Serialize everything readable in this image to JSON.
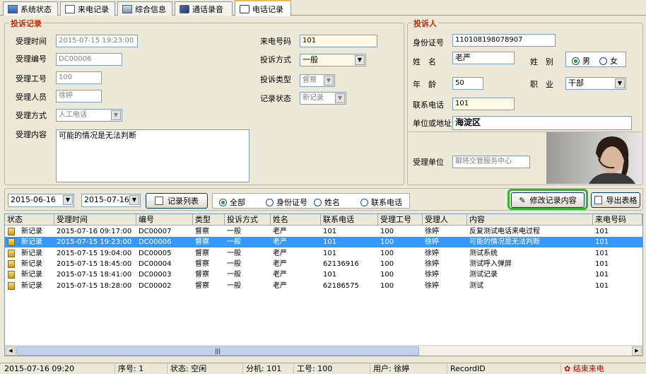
{
  "tabs": [
    {
      "label": "系统状态",
      "icon": "system-status-icon"
    },
    {
      "label": "来电记录",
      "icon": "call-log-icon"
    },
    {
      "label": "综合信息",
      "icon": "info-icon"
    },
    {
      "label": "通话录音",
      "icon": "recording-icon"
    },
    {
      "label": "电话记录",
      "icon": "phone-record-icon"
    }
  ],
  "complaint": {
    "title": "投诉记录",
    "receive_time_label": "受理时间",
    "receive_time": "2015-07-15 19:23:00",
    "receive_no_label": "受理编号",
    "receive_no": "DC00006",
    "worker_id_label": "受理工号",
    "worker_id": "100",
    "worker_label": "受理人员",
    "worker": "徐婷",
    "method_label": "受理方式",
    "method": "人工电话",
    "content_label": "受理内容",
    "content": "可能的情况是无法判断",
    "caller_no_label": "来电号码",
    "caller_no": "101",
    "type_label": "投诉方式",
    "type": "一般",
    "category_label": "投诉类型",
    "category": "督察",
    "record_status_label": "记录状态",
    "record_status": "新记录"
  },
  "complainant": {
    "title": "投诉人",
    "id_label": "身份证号",
    "id": "110108198078907",
    "name_label": "姓　名",
    "name": "老严",
    "gender_label": "姓　别",
    "male": "男",
    "female": "女",
    "gender": "男",
    "age_label": "年　龄",
    "age": "50",
    "job_label": "职　业",
    "job": "干部",
    "phone_label": "联系电话",
    "phone": "101",
    "address_label": "单位或地址",
    "address": "海淀区",
    "unit_label": "受理单位",
    "unit": "聊将交管服务中心"
  },
  "toolbar": {
    "date_from": "2015-06-16",
    "date_to": "2015-07-16",
    "record_list": "记录列表",
    "filter_all": "全部",
    "filter_id": "身份证号",
    "filter_name": "姓名",
    "filter_phone": "联系电话",
    "modify": "修改记录内容",
    "export": "导出表格"
  },
  "grid": {
    "columns": [
      "状态",
      "受理时间",
      "编号",
      "类型",
      "投诉方式",
      "姓名",
      "联系电话",
      "受理工号",
      "受理人",
      "内容",
      "来电号码"
    ],
    "rows": [
      [
        "新记录",
        "2015-07-16 09:17:00",
        "DC00007",
        "督察",
        "一般",
        "老严",
        "101",
        "100",
        "徐婷",
        "反复测试电话来电过程",
        "101"
      ],
      [
        "新记录",
        "2015-07-15 19:23:00",
        "DC00006",
        "督察",
        "一般",
        "老严",
        "101",
        "100",
        "徐婷",
        "可能的情况是无法判断",
        "101"
      ],
      [
        "新记录",
        "2015-07-15 19:04:00",
        "DC00005",
        "督察",
        "一般",
        "老严",
        "101",
        "100",
        "徐婷",
        " 测试系统",
        "101"
      ],
      [
        "新记录",
        "2015-07-15 18:45:00",
        "DC00004",
        "督察",
        "一般",
        "老严",
        "62136916",
        "100",
        "徐婷",
        "测试呼入弹屏",
        "101"
      ],
      [
        "新记录",
        "2015-07-15 18:41:00",
        "DC00003",
        "督察",
        "一般",
        "老严",
        "101",
        "100",
        "徐婷",
        "测试记录",
        "101"
      ],
      [
        "新记录",
        "2015-07-15 18:28:00",
        "DC00002",
        "督察",
        "一般",
        "老严",
        "62186575",
        "100",
        "徐婷",
        "测试",
        "101"
      ]
    ],
    "selected_row": 1,
    "scroll_grip": "|||"
  },
  "status_bar": {
    "date": "2015-07-16 09:20",
    "seq": "序号: 1",
    "state": "状态: 空闲",
    "ext": "分机: 101",
    "worker": "工号: 100",
    "user": "用户: 徐婷",
    "record": "RecordID",
    "end": "结束来电"
  },
  "colors": {
    "accent_red": "#cc2a00",
    "selection": "#3399ff",
    "highlight_green": "#2fb62f"
  }
}
